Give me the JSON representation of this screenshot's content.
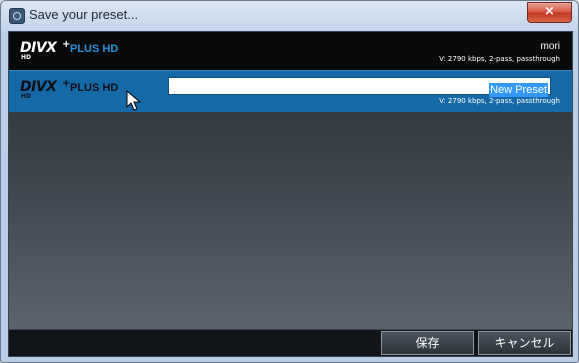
{
  "window": {
    "title": "Save your preset...",
    "close_label": "×"
  },
  "presets": {
    "existing": {
      "logo_main": "DIVX",
      "logo_plus": "+",
      "logo_sub": "HD",
      "logo_product": "PLUS HD",
      "name": "mori",
      "details": "V: 2790 kbps, 2-pass, passthrough"
    },
    "new": {
      "logo_main": "DIVX",
      "logo_plus": "+",
      "logo_sub": "HD",
      "logo_product": "PLUS HD",
      "name_value": "New Preset",
      "details": "V: 2790 kbps, 2-pass, passthrough"
    }
  },
  "buttons": {
    "save_label": "保存",
    "cancel_label": "キャンセル"
  },
  "colors": {
    "selected_row": "#1569a6",
    "existing_row": "#07090b",
    "brand_blue": "#2a8fd8"
  },
  "icons": {
    "app": "app-icon",
    "close": "close-icon",
    "cursor": "mouse-pointer-icon"
  }
}
